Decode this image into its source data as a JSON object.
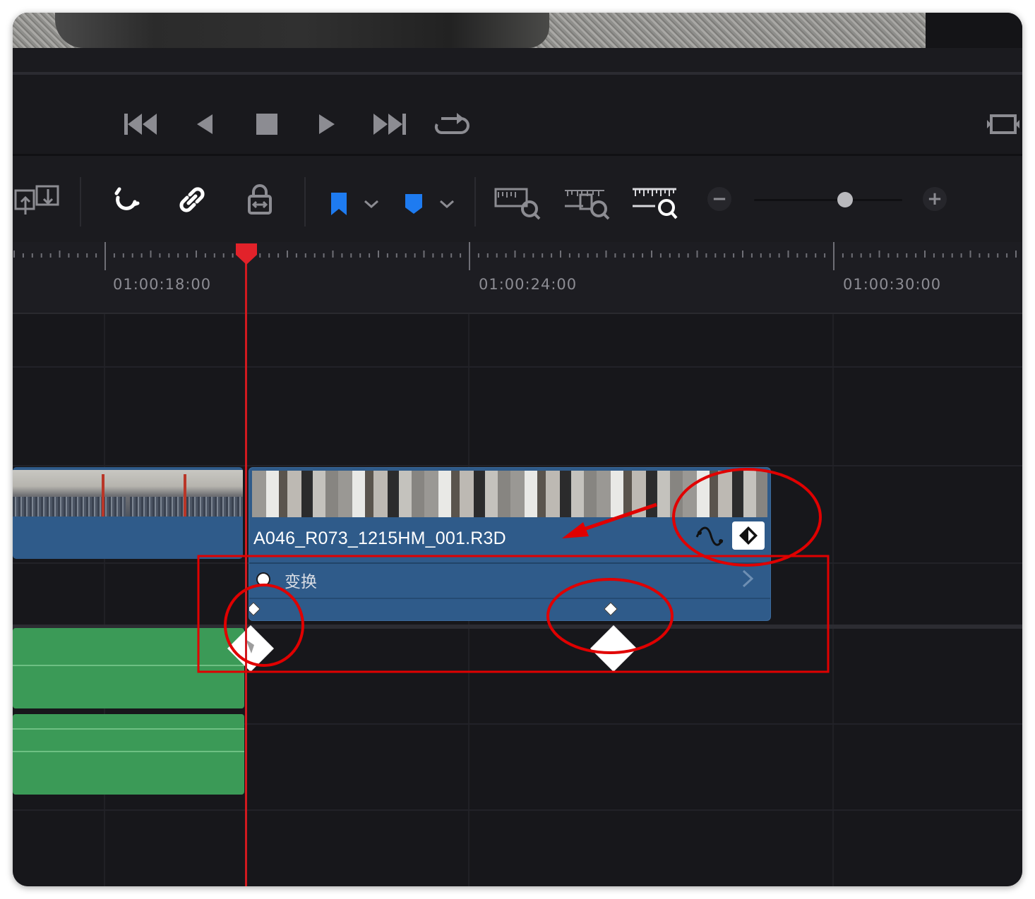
{
  "transport": {
    "buttons": [
      "skip-to-start",
      "step-back",
      "stop",
      "play",
      "skip-to-end",
      "loop"
    ]
  },
  "toolbar": {
    "tools": [
      "snapping",
      "linked-selection",
      "position-lock",
      "flag",
      "marker",
      "zoom-full",
      "zoom-detail",
      "zoom-custom"
    ],
    "zoom_minus": "−",
    "zoom_plus": "+",
    "zoom_level": 0.62
  },
  "ruler": {
    "timecodes": [
      "01:00:18:00",
      "01:00:24:00",
      "01:00:30:00"
    ]
  },
  "clip": {
    "name": "A046_R073_1215HM_001.R3D",
    "keyframe_track_label": "变换"
  },
  "colors": {
    "playhead": "#d1191f",
    "video_clip": "#2f5b8a",
    "audio_clip": "#3b9a57",
    "annotation": "#e00000",
    "accent_blue": "#1e7bf0"
  }
}
